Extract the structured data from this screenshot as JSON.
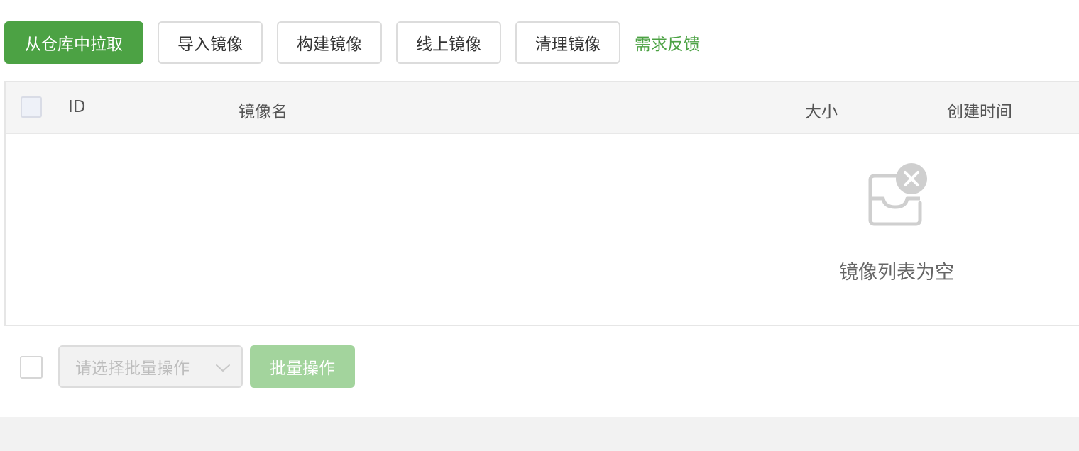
{
  "toolbar": {
    "pull_from_repo_label": "从仓库中拉取",
    "import_image_label": "导入镜像",
    "build_image_label": "构建镜像",
    "online_image_label": "线上镜像",
    "clean_image_label": "清理镜像",
    "feedback_label": "需求反馈"
  },
  "table": {
    "columns": [
      "ID",
      "镜像名",
      "大小",
      "创建时间"
    ],
    "rows": [],
    "empty_text": "镜像列表为空",
    "empty_icon": "empty-box-icon"
  },
  "bottom_bar": {
    "batch_select_placeholder": "请选择批量操作",
    "batch_button_label": "批量操作"
  },
  "colors": {
    "primary": "#4ca244",
    "primary_disabled": "#a3d49d",
    "link": "#4ca244"
  }
}
